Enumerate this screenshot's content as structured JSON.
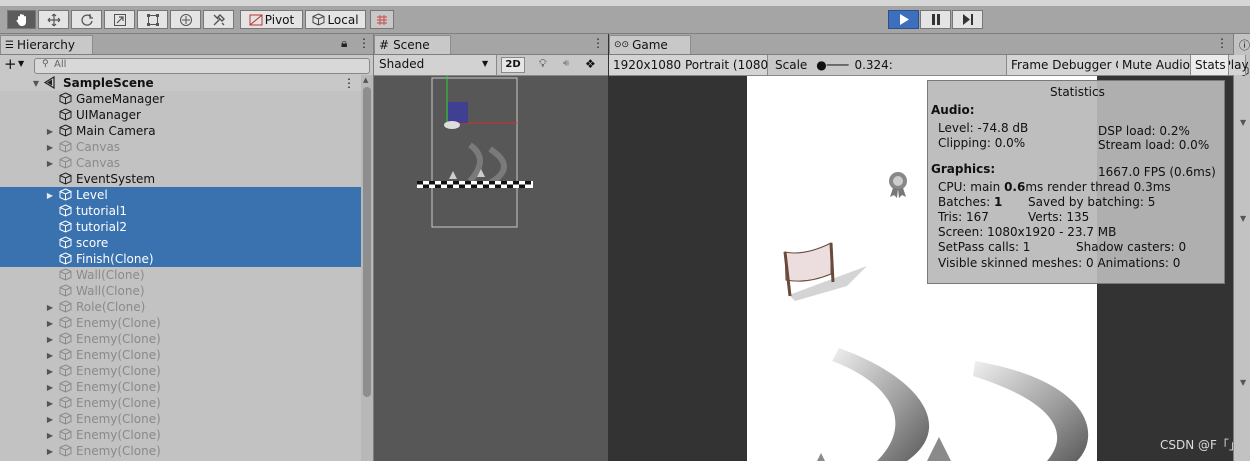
{
  "toolbar": {
    "tools": [
      "hand-tool-icon",
      "move-tool-icon",
      "rotate-tool-icon",
      "scale-tool-icon",
      "rect-tool-icon",
      "transform-tool-icon",
      "custom-tool-icon"
    ],
    "pivot_label": "Pivot",
    "local_label": "Local",
    "colors": {
      "play_active": "#3c6fbd"
    }
  },
  "hierarchy": {
    "tab_label": "Hierarchy",
    "add_label": "+",
    "search_placeholder": "All",
    "scene_name": "SampleScene",
    "items": [
      {
        "label": "GameManager",
        "expand": false,
        "dim": false,
        "selected": false
      },
      {
        "label": "UIManager",
        "expand": false,
        "dim": false,
        "selected": false
      },
      {
        "label": "Main Camera",
        "expand": true,
        "dim": false,
        "selected": false
      },
      {
        "label": "Canvas",
        "expand": true,
        "dim": true,
        "selected": false
      },
      {
        "label": "Canvas",
        "expand": true,
        "dim": true,
        "selected": false
      },
      {
        "label": "EventSystem",
        "expand": false,
        "dim": false,
        "selected": false
      },
      {
        "label": "Level",
        "expand": true,
        "dim": false,
        "selected": true
      },
      {
        "label": "tutorial1",
        "expand": false,
        "dim": false,
        "selected": true
      },
      {
        "label": "tutorial2",
        "expand": false,
        "dim": false,
        "selected": true
      },
      {
        "label": "score",
        "expand": false,
        "dim": false,
        "selected": true
      },
      {
        "label": "Finish(Clone)",
        "expand": false,
        "dim": false,
        "selected": true
      },
      {
        "label": "Wall(Clone)",
        "expand": false,
        "dim": true,
        "selected": false
      },
      {
        "label": "Wall(Clone)",
        "expand": false,
        "dim": true,
        "selected": false
      },
      {
        "label": "Role(Clone)",
        "expand": true,
        "dim": true,
        "selected": false
      },
      {
        "label": "Enemy(Clone)",
        "expand": true,
        "dim": true,
        "selected": false
      },
      {
        "label": "Enemy(Clone)",
        "expand": true,
        "dim": true,
        "selected": false
      },
      {
        "label": "Enemy(Clone)",
        "expand": true,
        "dim": true,
        "selected": false
      },
      {
        "label": "Enemy(Clone)",
        "expand": true,
        "dim": true,
        "selected": false
      },
      {
        "label": "Enemy(Clone)",
        "expand": true,
        "dim": true,
        "selected": false
      },
      {
        "label": "Enemy(Clone)",
        "expand": true,
        "dim": true,
        "selected": false
      },
      {
        "label": "Enemy(Clone)",
        "expand": true,
        "dim": true,
        "selected": false
      },
      {
        "label": "Enemy(Clone)",
        "expand": true,
        "dim": true,
        "selected": false
      },
      {
        "label": "Enemy(Clone)",
        "expand": true,
        "dim": true,
        "selected": false
      }
    ],
    "colors": {
      "selection": "#3a72b0"
    }
  },
  "scene": {
    "tab_label": "Scene",
    "shading_mode": "Shaded",
    "mode_2d_label": "2D"
  },
  "game": {
    "tab_label": "Game",
    "resolution": "1920x1080 Portrait (1080",
    "scale_label": "Scale",
    "scale_value": "0.324:",
    "frame_debugger_label": "Frame Debugger On",
    "maximize_label": "Maximize On Play",
    "mute_label": "Mute Audio",
    "stats_label": "Stats"
  },
  "stats": {
    "title": "Statistics",
    "audio_heading": "Audio:",
    "level": "Level: -74.8 dB",
    "dsp": "DSP load: 0.2%",
    "clipping": "Clipping: 0.0%",
    "stream": "Stream load: 0.0%",
    "graphics_heading": "Graphics:",
    "fps": "1667.0 FPS (0.6ms)",
    "cpu_prefix": "CPU: main ",
    "cpu_main": "0.6",
    "cpu_suffix": "ms  render thread 0.3ms",
    "batches_prefix": "Batches: ",
    "batches_value": "1",
    "saved_batching": "Saved by batching: 5",
    "tris": "Tris: 167",
    "verts": "Verts: 135",
    "screen": "Screen: 1080x1920 - 23.7 MB",
    "setpass": "SetPass calls: 1",
    "shadow": "Shadow casters: 0",
    "skinned": "Visible skinned meshes: 0  Animations: 0"
  },
  "watermark": "CSDN @F「」"
}
